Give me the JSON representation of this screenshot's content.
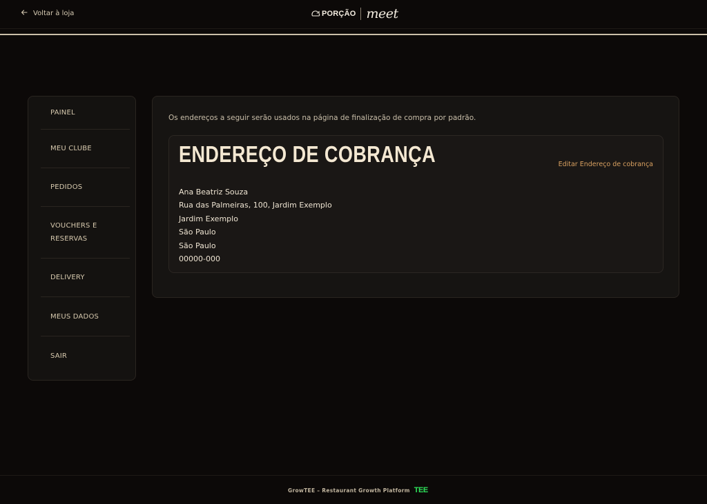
{
  "header": {
    "back_label": "Voltar à loja",
    "brand_primary": "PORÇÃO",
    "brand_secondary": "meet"
  },
  "sidebar": {
    "items": [
      {
        "label": "PAINEL"
      },
      {
        "label": "MEU CLUBE"
      },
      {
        "label": "PEDIDOS"
      },
      {
        "label": "VOUCHERS E RESERVAS"
      },
      {
        "label": "DELIVERY"
      },
      {
        "label": "MEUS DADOS"
      },
      {
        "label": "SAIR"
      }
    ]
  },
  "main": {
    "intro_text": "Os endereços a seguir serão usados na página de finalização de compra por padrão.",
    "billing": {
      "title": "ENDEREÇO DE COBRANÇA",
      "edit_label": "Editar Endereço de cobrança",
      "lines": [
        "Ana Beatriz Souza",
        "Rua das Palmeiras, 100, Jardim Exemplo",
        "Jardim Exemplo",
        "São Paulo",
        "São Paulo",
        "00000-000"
      ]
    }
  },
  "footer": {
    "text": "GrowTEE – Restaurant Growth Platform",
    "logo_text": "TEE"
  },
  "colors": {
    "background": "#0c0908",
    "accent_link": "#d8a060",
    "footer_logo": "#2ee05a"
  }
}
